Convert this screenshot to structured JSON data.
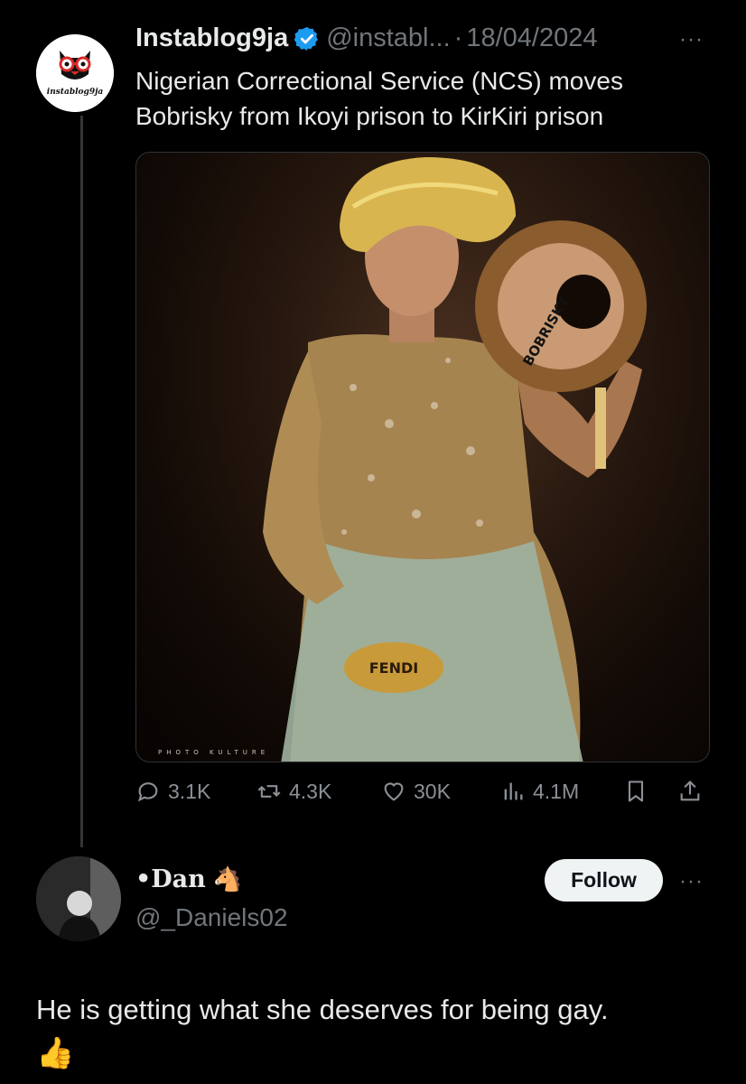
{
  "tweet": {
    "author_name": "Instablog9ja",
    "verified": true,
    "handle": "@instabl...",
    "separator": "·",
    "date": "18/04/2024",
    "more": "···",
    "text": "Nigerian Correctional Service (NCS) moves Bobrisky from Ikoyi prison to KirKiri prison",
    "avatar_logo_text": "instablog9ja",
    "media": {
      "fan_text": "BOBRISKY",
      "bag_text": "FENDI",
      "watermark": "PHOTO KULTURE"
    },
    "actions": {
      "replies": "3.1K",
      "retweets": "4.3K",
      "likes": "30K",
      "views": "4.1M"
    }
  },
  "reply": {
    "name": "•Dan",
    "emoji": "🐴",
    "handle": "@_Daniels02",
    "follow_label": "Follow",
    "more": "···",
    "text": "He is getting what she deserves for being gay.",
    "trailing_emoji": "👍"
  },
  "colors": {
    "background": "#000000",
    "text_primary": "#e7e9ea",
    "text_secondary": "#71767b",
    "verified_blue": "#1d9bf0",
    "thread_line": "#333639"
  },
  "icons": [
    "verified-badge-icon",
    "reply-icon",
    "retweet-icon",
    "like-icon",
    "views-icon",
    "bookmark-icon",
    "share-icon",
    "more-icon",
    "horse-icon",
    "thumbs-up-icon"
  ]
}
